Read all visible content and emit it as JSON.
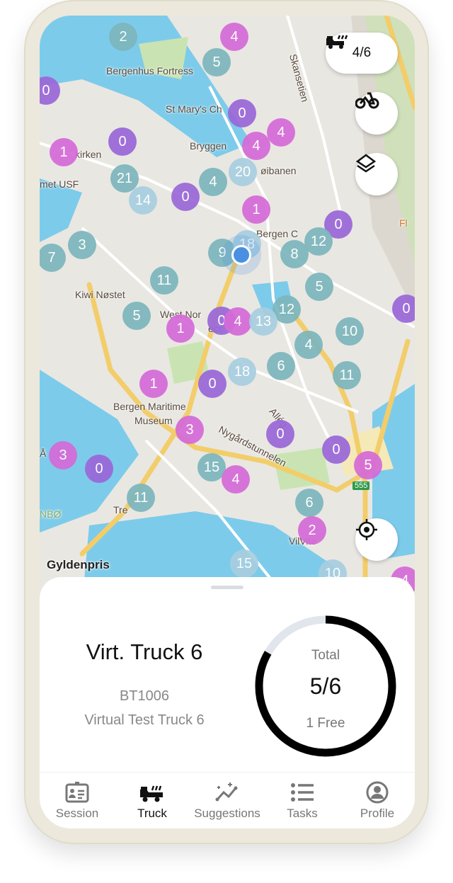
{
  "map": {
    "labels": [
      "Bergenhus Fortress",
      "St Mary's Ch",
      "Bryggen",
      "Skansetien",
      "kirken",
      "met USF",
      "øibanen",
      "Bergen C",
      "Fl",
      "Kiwi Nøstet",
      "West Nor",
      "ecc",
      "Bergen Maritime",
      "Museum",
      "Allég",
      "Nygårdstunnelen",
      "555",
      "Tre",
      "NBØ",
      "VilVite",
      "Gyldenpris",
      "Å"
    ],
    "cluster_counts": [
      2,
      4,
      5,
      0,
      0,
      4,
      4,
      0,
      1,
      20,
      21,
      4,
      0,
      14,
      1,
      0,
      12,
      3,
      7,
      9,
      18,
      8,
      11,
      5,
      0,
      12,
      5,
      0,
      4,
      13,
      1,
      10,
      4,
      6,
      11,
      18,
      0,
      1,
      3,
      0,
      0,
      3,
      0,
      5,
      15,
      4,
      11,
      6,
      2,
      15,
      10,
      4
    ],
    "colors": {
      "teal": "#7db6bd",
      "purple": "#9a68d8",
      "pink": "#d56bd8",
      "light": "#a8cfe0",
      "water": "#7dcbea",
      "road": "#f2cd6a",
      "park": "#c9e4b2",
      "user_location": "#4a90e2"
    }
  },
  "truck_capacity": {
    "icon": "truck-icon",
    "label": "4/6"
  },
  "buttons": {
    "bike": "bike-icon",
    "layers": "layers-icon",
    "locate": "crosshair-icon"
  },
  "card": {
    "title": "Virt. Truck 6",
    "id": "BT1006",
    "name": "Virtual Test Truck 6",
    "ring": {
      "label": "Total",
      "value": "5/6",
      "free": "1 Free",
      "fill_fraction": 0.8333
    }
  },
  "nav": [
    {
      "label": "Session",
      "icon": "id-badge-icon",
      "active": false
    },
    {
      "label": "Truck",
      "icon": "truck-icon",
      "active": true
    },
    {
      "label": "Suggestions",
      "icon": "sparkle-chart-icon",
      "active": false
    },
    {
      "label": "Tasks",
      "icon": "list-icon",
      "active": false
    },
    {
      "label": "Profile",
      "icon": "profile-icon",
      "active": false
    }
  ]
}
